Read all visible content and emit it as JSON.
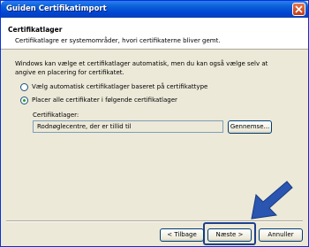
{
  "window": {
    "title": "Guiden Certifikatimport"
  },
  "header": {
    "title": "Certifikatlager",
    "description": "Certifikatlagre er systemområder, hvori certifikaterne bliver gemt."
  },
  "intro": {
    "line1": "Windows kan vælge et certifikatlager automatisk, men du kan også vælge selv at",
    "line2": "angive en placering for certifikatet."
  },
  "options": {
    "auto_label": "Vælg automatisk certifikatlager baseret på certifikattype",
    "manual_label": "Placer alle certifikater i følgende certifikatlager",
    "selected": "manual"
  },
  "store": {
    "label": "Certifikatlager:",
    "value": "Rodnøglecentre, der er tillid til",
    "browse_label": "Gennemse..."
  },
  "footer": {
    "back_label": "< Tilbage",
    "next_label": "Næste >",
    "cancel_label": "Annuller"
  },
  "colors": {
    "titlebar": "#0a5fd6",
    "dialog_bg": "#ece9d8",
    "arrow": "#2a55b0",
    "radio_dot": "#21a121"
  },
  "icons": {
    "close": "close-icon",
    "pointer": "pointer-arrow-icon"
  }
}
